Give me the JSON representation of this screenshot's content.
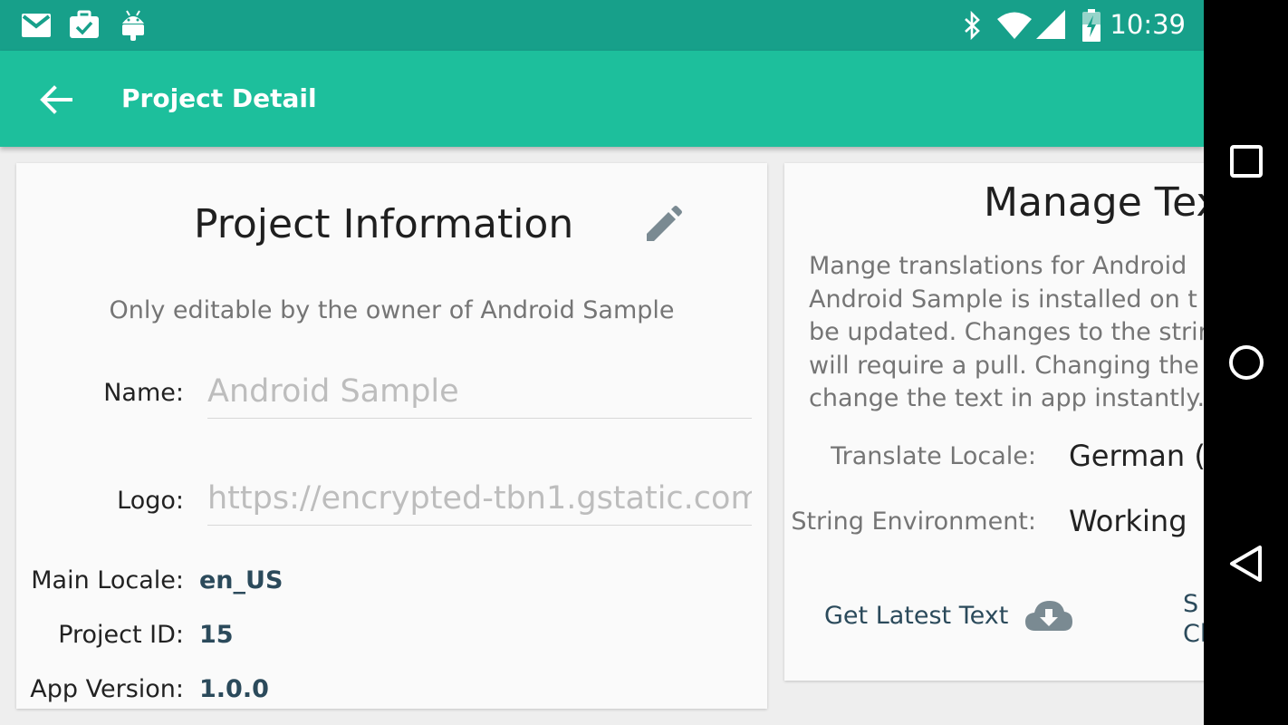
{
  "status_bar": {
    "time": "10:39",
    "icons_left": [
      "gmail-icon",
      "work-briefcase-icon",
      "android-debug-icon"
    ],
    "icons_right": [
      "bluetooth-icon",
      "wifi-icon",
      "cell-signal-icon",
      "battery-charging-icon"
    ]
  },
  "app_bar": {
    "title": "Project Detail",
    "back_icon": "arrow-back-icon",
    "background": "#1dbf9c"
  },
  "project_info": {
    "title": "Project Information",
    "edit_icon": "pencil-icon",
    "subtitle": "Only editable by the owner of Android Sample",
    "name_label": "Name:",
    "name_value": "Android Sample",
    "logo_label": "Logo:",
    "logo_value": "https://encrypted-tbn1.gstatic.com",
    "main_locale_label": "Main Locale:",
    "main_locale_value": "en_US",
    "project_id_label": "Project ID:",
    "project_id_value": "15",
    "app_version_label": "App Version:",
    "app_version_value": "1.0.0"
  },
  "manage_text": {
    "title": "Manage Tex",
    "description_lines": [
      "Mange translations for Android",
      "Android Sample is installed on t",
      "be updated. Changes to the strir",
      "will require a pull. Changing the",
      "change the text in app instantly."
    ],
    "translate_locale_label": "Translate Locale:",
    "translate_locale_value": "German (",
    "string_env_label": "String Environment:",
    "string_env_value": "Working",
    "get_latest_label": "Get Latest Text",
    "get_latest_icon": "cloud-download-icon",
    "save_label_line1": "S",
    "save_label_line2": "Cl"
  },
  "colors": {
    "status_bar": "#17a08a",
    "accent_text": "#2b4a5b",
    "card": "#fafafa"
  }
}
